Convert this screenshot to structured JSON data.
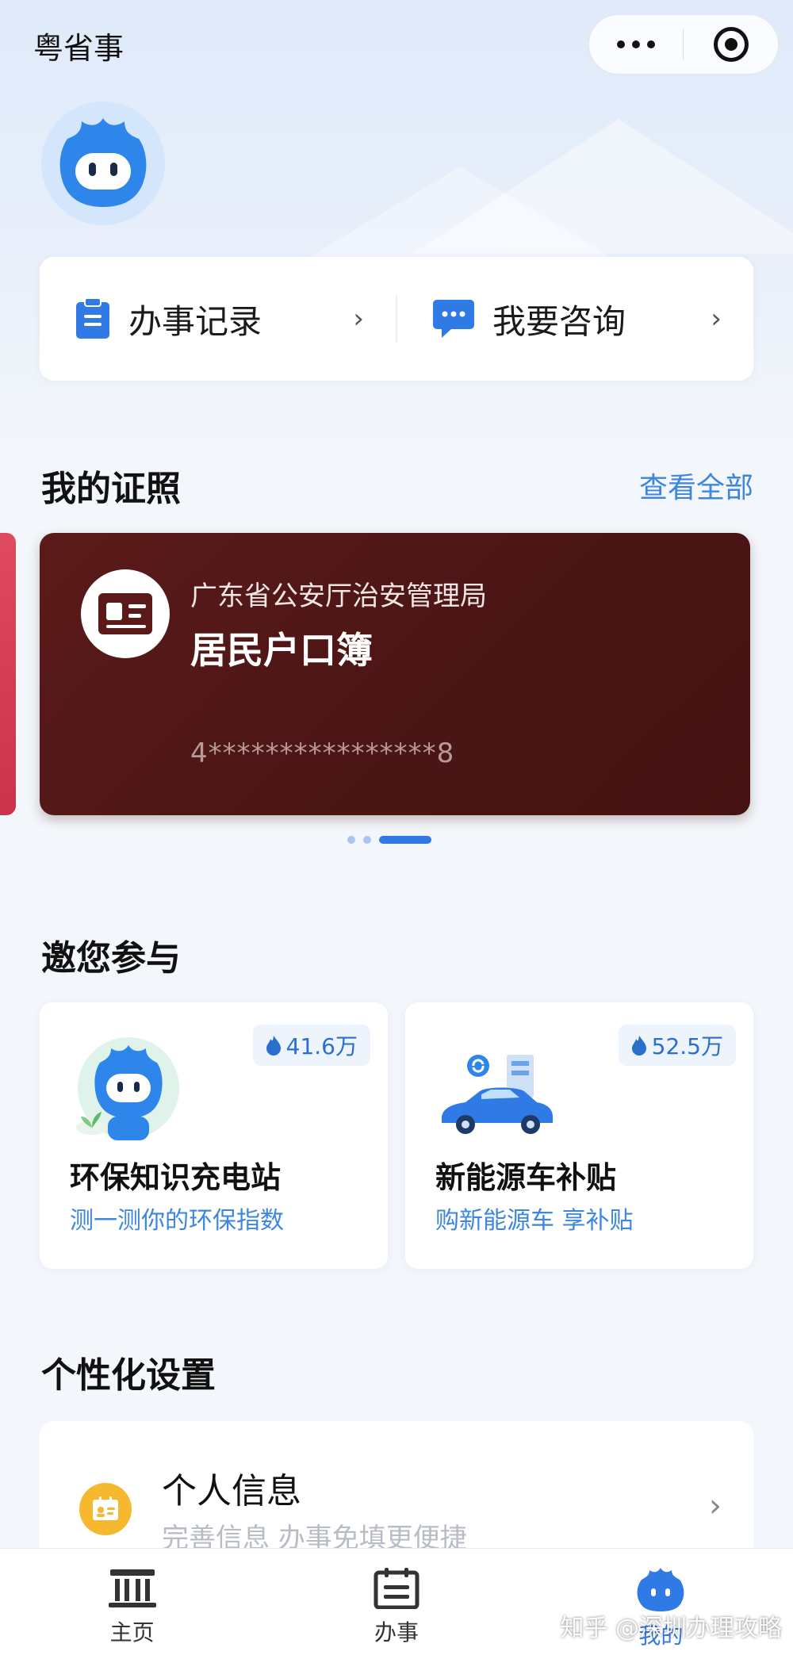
{
  "header": {
    "app_title": "粤省事"
  },
  "quick": {
    "records_label": "办事记录",
    "consult_label": "我要咨询"
  },
  "licenses": {
    "section_title": "我的证照",
    "see_all": "查看全部",
    "card": {
      "issuer": "广东省公安厅治安管理局",
      "name": "居民户口簿",
      "number": "4****************8"
    }
  },
  "participate": {
    "section_title": "邀您参与",
    "items": [
      {
        "count": "41.6万",
        "title": "环保知识充电站",
        "subtitle": "测一测你的环保指数"
      },
      {
        "count": "52.5万",
        "title": "新能源车补贴",
        "subtitle": "购新能源车 享补贴"
      }
    ]
  },
  "settings": {
    "section_title": "个性化设置",
    "item_title": "个人信息",
    "item_subtitle": "完善信息 办事免填更便捷"
  },
  "tabbar": {
    "home": "主页",
    "services": "办事",
    "mine": "我的"
  },
  "watermark": "知乎 @深圳办理攻略",
  "colors": {
    "accent": "#2f7ae5",
    "license_card": "#4a1515",
    "badge_text": "#2a6fce"
  }
}
